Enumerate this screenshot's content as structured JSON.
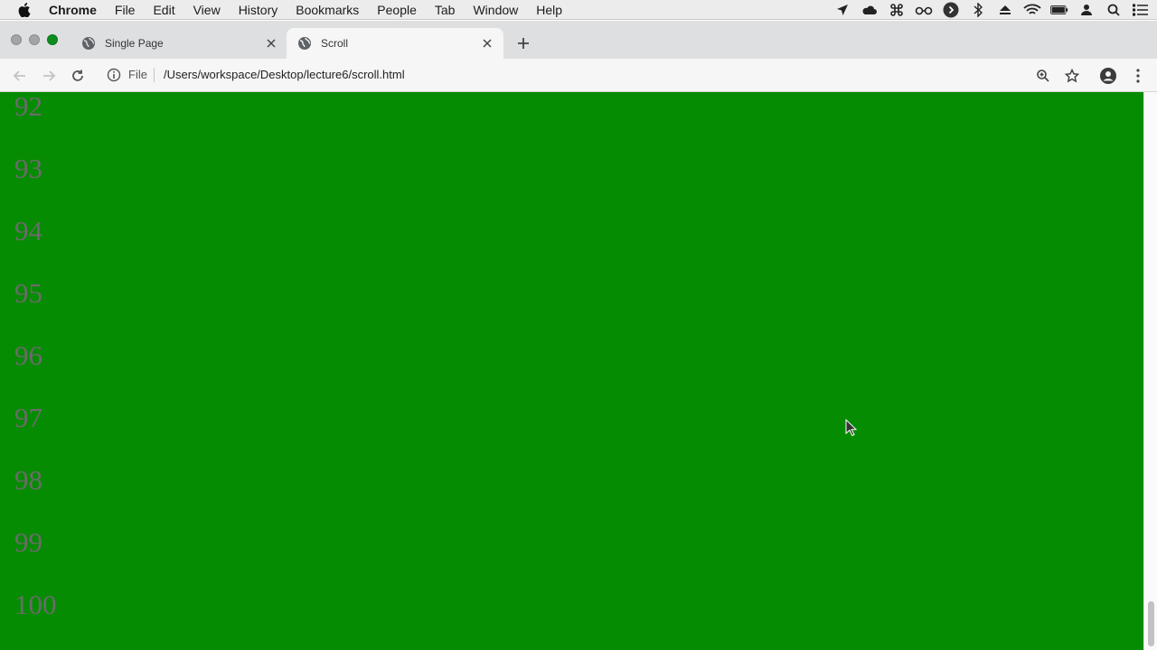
{
  "menubar": {
    "app_name": "Chrome",
    "items": [
      "File",
      "Edit",
      "View",
      "History",
      "Bookmarks",
      "People",
      "Tab",
      "Window",
      "Help"
    ]
  },
  "tabs": [
    {
      "title": "Single Page",
      "active": false
    },
    {
      "title": "Scroll",
      "active": true
    }
  ],
  "toolbar": {
    "scheme_label": "File",
    "url": "/Users/workspace/Desktop/lecture6/scroll.html"
  },
  "page": {
    "background_color": "#068c02",
    "number_color": "#6b6b6b",
    "numbers": [
      "92",
      "93",
      "94",
      "95",
      "96",
      "97",
      "98",
      "99",
      "100"
    ]
  },
  "icons": {
    "tray": [
      "location-arrow-icon",
      "cloud-icon",
      "command-icon",
      "glasses-icon",
      "play-circle-icon",
      "bluetooth-icon",
      "eject-icon",
      "wifi-icon",
      "battery-icon",
      "user-icon",
      "spotlight-search-icon",
      "notification-list-icon"
    ]
  }
}
